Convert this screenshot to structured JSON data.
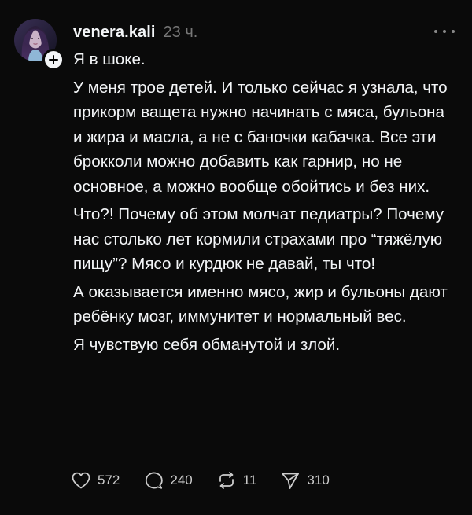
{
  "post": {
    "username": "venera.kali",
    "timestamp": "23 ч.",
    "paragraphs": [
      "Я в шоке.",
      "У меня трое детей. И только сейчас я узнала, что прикорм ващета нужно начинать с мяса, бульона и жира и масла, а не с баночки кабачка. Все эти брокколи можно добавить как гарнир, но не основное, а можно вообще обойтись и без них.",
      "Что?! Почему об этом молчат педиатры? Почему нас столько лет кормили страхами про “тяжёлую пищу”? Мясо и курдюк не давай, ты что!",
      "А оказывается именно мясо, жир и бульоны дают ребёнку мозг, иммунитет и нормальный вес.",
      "Я чувствую себя обманутой и злой."
    ],
    "actions": {
      "likes": "572",
      "comments": "240",
      "reposts": "11",
      "shares": "310"
    }
  },
  "icons": {
    "follow": "plus-icon",
    "more": "more-horizontal-icon",
    "like": "heart-icon",
    "comment": "speech-bubble-icon",
    "repost": "repost-icon",
    "share": "send-icon"
  },
  "colors": {
    "background": "#0a0a0a",
    "text": "#f3f5f7",
    "muted": "#777777",
    "action_text": "#cccccc"
  }
}
